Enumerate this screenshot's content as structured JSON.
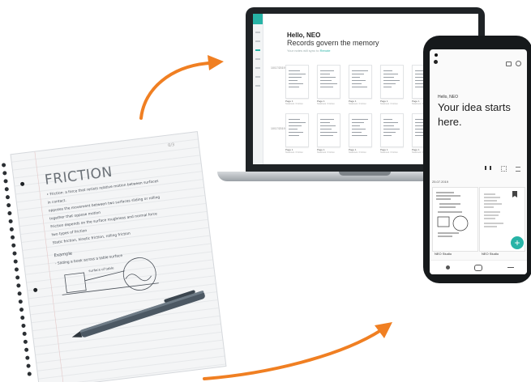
{
  "laptop": {
    "greeting": "Hello, NEO",
    "tagline": "Records govern the memory",
    "subtitle_prefix": "Your notes will sync to",
    "subtitle_link": "Renote",
    "groups": [
      {
        "date": "10/17/2019"
      },
      {
        "date": "10/17/2019"
      }
    ],
    "page_label": "Page 1",
    "page_meta": "Notebook / Friction"
  },
  "phone": {
    "greeting": "Hello, NEO",
    "headline": "Your idea starts here.",
    "date": "25.07.2019",
    "cards": [
      {
        "title": "NEO Studio"
      },
      {
        "title": "NEO Studio"
      }
    ],
    "fab_icon": "plus-icon"
  },
  "notebook": {
    "title": "FRICTION",
    "page_number": "0/3",
    "lines": [
      "• Friction: a force that resists relative motion between surfaces",
      "  in contact.",
      "  opposes the movement between two surfaces sliding or rolling",
      "  together that oppose motion",
      "  Friction depends on the surface roughness and normal force",
      "  two types of friction",
      "  Static friction, kinetic friction, rolling friction"
    ],
    "example_heading": "Example",
    "example_line": "- Sliding a book across a table surface",
    "diagram_label": "surface of table"
  },
  "colors": {
    "accent": "#27b3a6",
    "arrow": "#f07f22",
    "device_dark": "#1f2326"
  }
}
